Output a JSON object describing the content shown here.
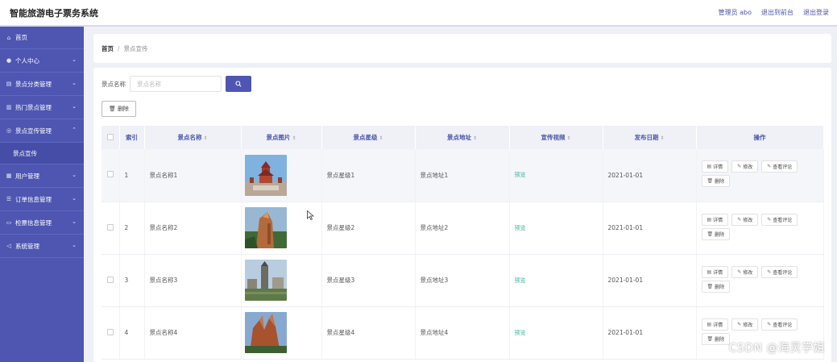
{
  "header": {
    "title": "智能旅游电子票务系统",
    "admin_label": "管理员 abo",
    "exit_frontend": "退出到前台",
    "logout": "退出登录"
  },
  "sidebar": {
    "home": "首页",
    "items": [
      {
        "label": "个人中心",
        "icon": "user-icon"
      },
      {
        "label": "景点分类管理",
        "icon": "list-icon"
      },
      {
        "label": "热门景点管理",
        "icon": "fire-icon"
      },
      {
        "label": "景点宣传管理",
        "icon": "speaker-icon",
        "expanded": true,
        "sub": "景点宣传"
      },
      {
        "label": "用户管理",
        "icon": "grid-icon"
      },
      {
        "label": "订单信息管理",
        "icon": "order-icon"
      },
      {
        "label": "检票信息管理",
        "icon": "ticket-icon"
      },
      {
        "label": "系统管理",
        "icon": "settings-icon"
      }
    ]
  },
  "breadcrumb": {
    "home": "首页",
    "separator": "/",
    "current": "景点宣传"
  },
  "search": {
    "label": "景点名称",
    "placeholder": "景点名称"
  },
  "toolbar": {
    "delete_label": "删除"
  },
  "table": {
    "headers": {
      "index": "索引",
      "name": "景点名称",
      "image": "景点图片",
      "level": "景点星级",
      "address": "景点地址",
      "video": "宣传视频",
      "date": "发布日期",
      "actions": "操作"
    },
    "rows": [
      {
        "index": "1",
        "name": "景点名称1",
        "level": "景点星级1",
        "address": "景点地址1",
        "video": "预览",
        "date": "2021-01-01"
      },
      {
        "index": "2",
        "name": "景点名称2",
        "level": "景点星级2",
        "address": "景点地址2",
        "video": "预览",
        "date": "2021-01-01"
      },
      {
        "index": "3",
        "name": "景点名称3",
        "level": "景点星级3",
        "address": "景点地址3",
        "video": "预览",
        "date": "2021-01-01"
      },
      {
        "index": "4",
        "name": "景点名称4",
        "level": "景点星级4",
        "address": "景点地址4",
        "video": "预览",
        "date": "2021-01-01"
      }
    ],
    "actions": {
      "detail": "详情",
      "edit": "修改",
      "comments": "查看评论",
      "delete": "删除"
    }
  },
  "watermark": "CSDN @海灵学姐",
  "colors": {
    "sidebar": "#4e56b2",
    "accent": "#4e56b2",
    "video_link": "#39b5a0"
  }
}
